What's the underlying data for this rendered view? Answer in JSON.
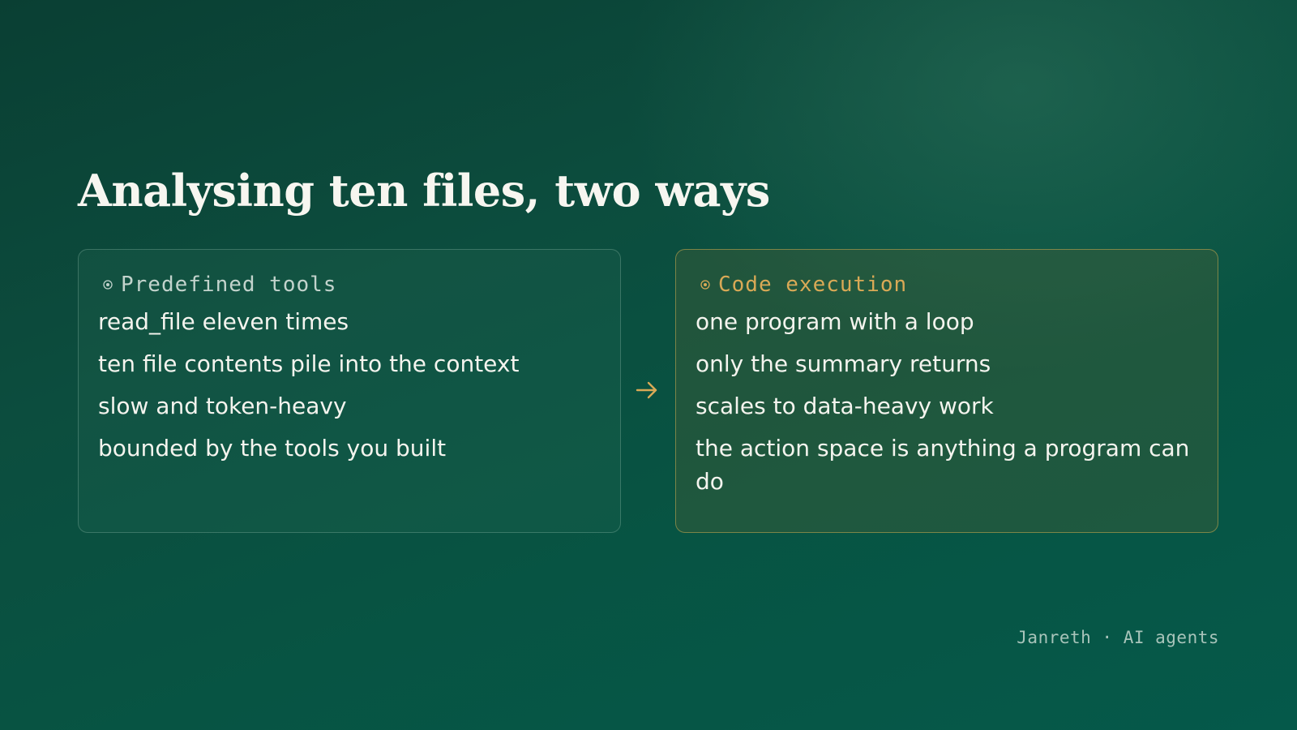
{
  "title": "Analysing ten files, two ways",
  "left_panel": {
    "label": "Predefined tools",
    "icon": "target-dot-icon",
    "items": [
      "read_file eleven times",
      "ten file contents pile into the context",
      "slow and token-heavy",
      "bounded by the tools you built"
    ]
  },
  "right_panel": {
    "label": "Code execution",
    "icon": "target-dot-icon",
    "items": [
      "one program with a loop",
      "only the summary returns",
      "scales to data-heavy work",
      "the action space is anything a program can do"
    ]
  },
  "arrow_icon": "arrow-right-icon",
  "footer": "Janreth · AI agents",
  "colors": {
    "accent": "#d9a956",
    "muted": "#c2d3cc",
    "text": "#f4f4ee"
  }
}
